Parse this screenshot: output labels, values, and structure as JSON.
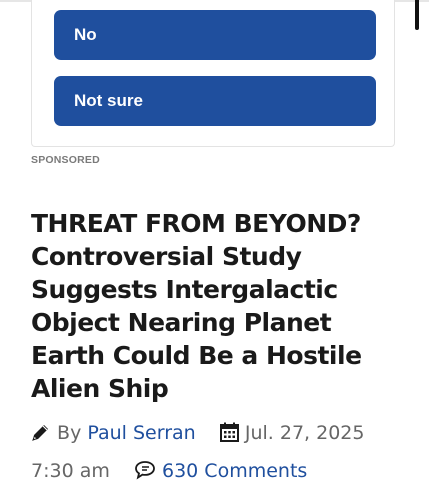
{
  "poll": {
    "options": [
      {
        "label": "No"
      },
      {
        "label": "Not sure"
      }
    ]
  },
  "sponsored_label": "SPONSORED",
  "article": {
    "headline": "THREAT FROM BEYOND? Controversial Study Suggests Intergalactic Object Nearing Planet Earth Could Be a Hostile Alien Ship",
    "by_label": "By",
    "author": "Paul Serran",
    "date": "Jul. 27, 2025 7:30 am",
    "comments": "630 Comments"
  },
  "colors": {
    "accent": "#1f4f9e",
    "meta_text": "#666666",
    "headline_text": "#1a1a1a"
  },
  "icons": [
    "pencil-icon",
    "calendar-icon",
    "comment-bubble-icon"
  ]
}
